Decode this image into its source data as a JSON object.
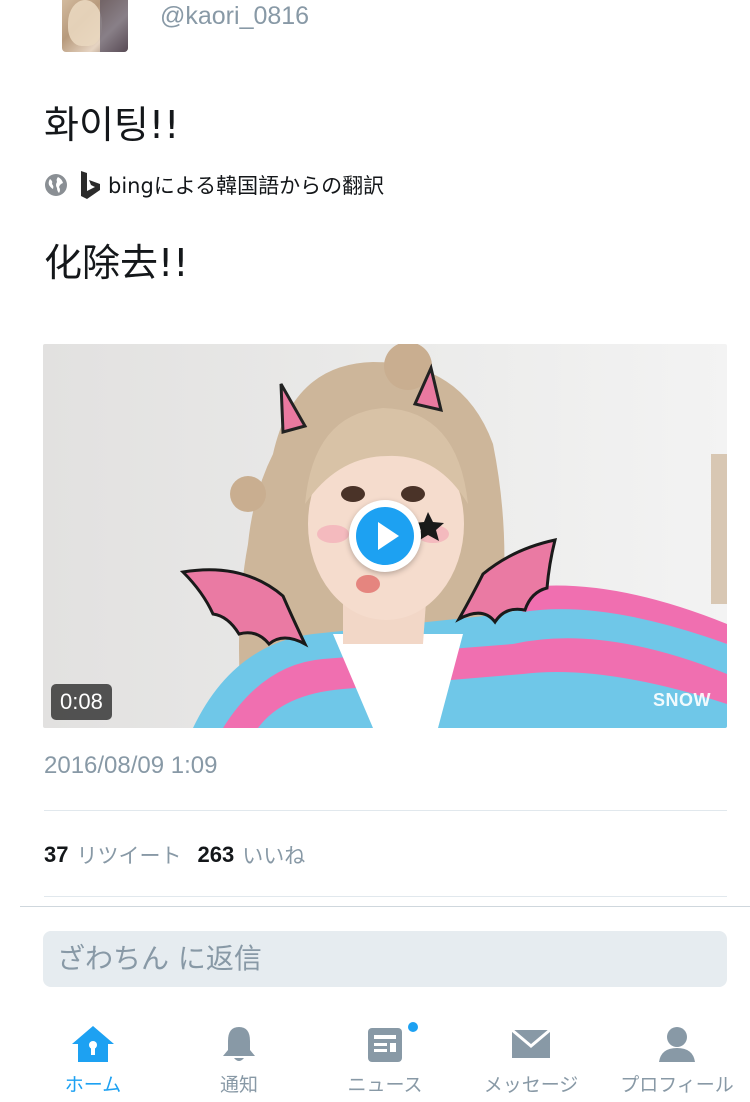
{
  "tweet": {
    "handle": "@kaori_0816",
    "text": "화이팅!!",
    "translation_label": "bingによる韓国語からの翻訳",
    "translated_text": "化除去!!",
    "timestamp": "2016/08/09 1:09"
  },
  "media": {
    "duration": "0:08",
    "watermark": "SNOW"
  },
  "stats": {
    "retweets_count": "37",
    "retweets_label": "リツイート",
    "likes_count": "263",
    "likes_label": "いいね"
  },
  "reply": {
    "placeholder": "ざわちん に返信"
  },
  "tabbar": {
    "home": "ホーム",
    "notifications": "通知",
    "news": "ニュース",
    "messages": "メッセージ",
    "profile": "プロフィール"
  },
  "colors": {
    "accent": "#1da1f2",
    "inactive": "#8899a6"
  }
}
